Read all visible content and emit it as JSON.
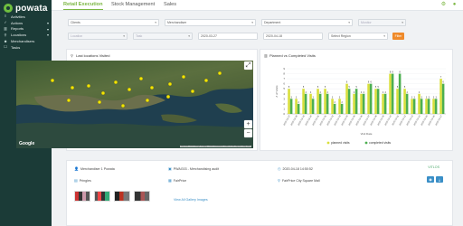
{
  "brand": {
    "name": "powata"
  },
  "sidebar": {
    "items": [
      {
        "label": "Activities",
        "icon": "list-icon",
        "has_caret": false
      },
      {
        "label": "Actions",
        "icon": "check-icon",
        "has_caret": true
      },
      {
        "label": "Reports",
        "icon": "chart-icon",
        "has_caret": true
      },
      {
        "label": "Locations",
        "icon": "pin-icon",
        "has_caret": true
      },
      {
        "label": "Merchandisers",
        "icon": "user-icon",
        "has_caret": false
      },
      {
        "label": "Tasks",
        "icon": "task-icon",
        "has_caret": false
      }
    ]
  },
  "topnav": {
    "tabs": [
      {
        "label": "Retail Execution",
        "active": true
      },
      {
        "label": "Stock Management",
        "active": false
      },
      {
        "label": "Sales",
        "active": false
      }
    ]
  },
  "filters": {
    "row1": [
      {
        "value": "Clients",
        "disabled": false
      },
      {
        "value": "Merchandiser",
        "disabled": false
      },
      {
        "value": "Department",
        "disabled": false
      },
      {
        "value": "Monitor",
        "disabled": true
      }
    ],
    "row2": [
      {
        "value": "Location",
        "disabled": true
      },
      {
        "value": "Task",
        "disabled": true
      },
      {
        "value": "2020-03-27",
        "disabled": false
      },
      {
        "value": "2020-04-18",
        "disabled": false
      },
      {
        "value": "Select Region",
        "disabled": false
      }
    ],
    "button_label": "Filter"
  },
  "map_panel": {
    "title": "Last locations Visited",
    "google_label": "Google",
    "attribution": "Map data ©2020 Google Imagery ©2020 TerraMetrics Terms of Use Report a map error",
    "fullscreen_symbol": "⤢",
    "zoom_in_symbol": "+",
    "zoom_out_symbol": "−"
  },
  "chart_data": {
    "type": "bar",
    "title": "Planned vs Completed Visits",
    "xlabel": "Visit Date",
    "ylabel": "# of Visits",
    "categories": [
      "2020-03-27",
      "2020-03-28",
      "2020-03-29",
      "2020-03-30",
      "2020-03-31",
      "2020-04-01",
      "2020-04-02",
      "2020-04-03",
      "2020-04-04",
      "2020-04-05",
      "2020-04-06",
      "2020-04-07",
      "2020-04-08",
      "2020-04-09",
      "2020-04-10",
      "2020-04-11",
      "2020-04-12",
      "2020-04-13",
      "2020-04-14",
      "2020-04-15",
      "2020-04-16",
      "2020-04-17"
    ],
    "series": [
      {
        "name": "planned visits",
        "values": [
          5,
          3,
          5,
          4,
          5,
          5,
          3,
          3,
          6,
          4,
          4,
          6,
          5,
          4,
          8,
          5,
          5,
          3,
          4,
          3,
          3,
          7
        ]
      },
      {
        "name": "completed visits",
        "values": [
          3,
          2,
          4,
          3,
          4,
          4,
          2,
          2,
          5,
          5,
          4,
          6,
          5,
          4,
          8,
          8,
          4,
          3,
          3,
          3,
          3,
          6
        ]
      }
    ],
    "colors": [
      "#d9df3a",
      "#4caf50"
    ],
    "ylim": [
      0,
      9
    ],
    "legend": "bottom"
  },
  "visit_card": {
    "merchandiser": "Merchandiser 1 Powata",
    "visit_code": "PWAG03 - Merchandising audit",
    "datetime": "2020-04-18 14:50:52",
    "status": "VITLOS",
    "client": "Pringles",
    "brand": "FairPrice",
    "location": "FairPrice City Square Mall",
    "link_label": "View All Gallery Images",
    "thumb_count": 4
  },
  "colors": {
    "sidebar": "#1b3b37",
    "accent": "#7ab640",
    "filter_button": "#ef8a2a",
    "link": "#3a8fc7"
  }
}
